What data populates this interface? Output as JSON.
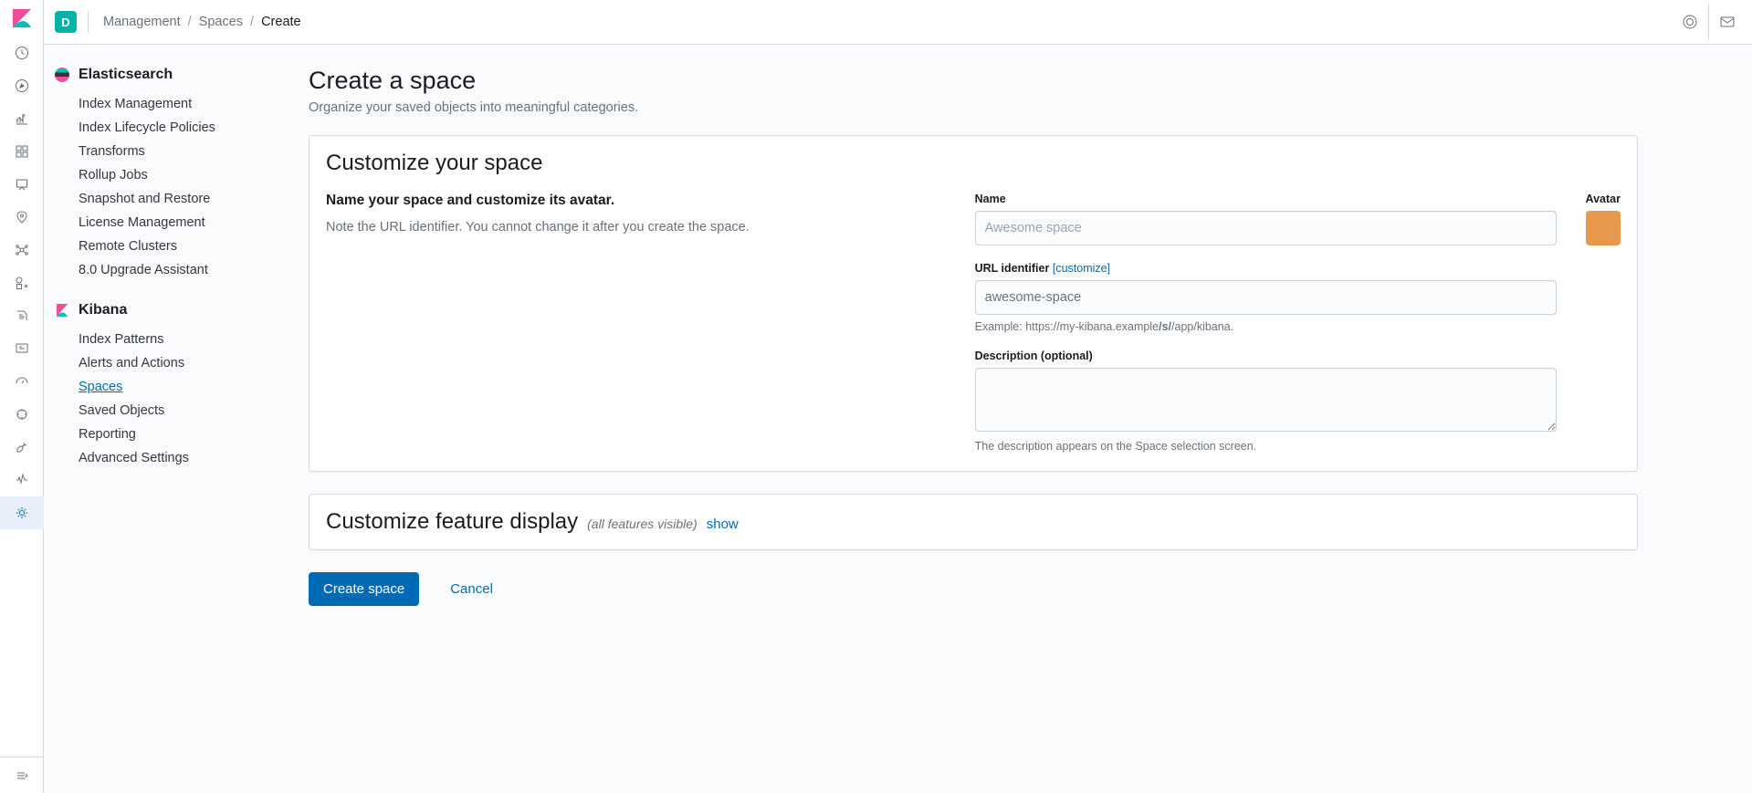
{
  "topbar": {
    "space_initial": "D",
    "breadcrumb": [
      "Management",
      "Spaces",
      "Create"
    ]
  },
  "sidebar": {
    "es": {
      "title": "Elasticsearch",
      "items": [
        "Index Management",
        "Index Lifecycle Policies",
        "Transforms",
        "Rollup Jobs",
        "Snapshot and Restore",
        "License Management",
        "Remote Clusters",
        "8.0 Upgrade Assistant"
      ]
    },
    "kib": {
      "title": "Kibana",
      "items": [
        "Index Patterns",
        "Alerts and Actions",
        "Spaces",
        "Saved Objects",
        "Reporting",
        "Advanced Settings"
      ],
      "active_index": 2
    }
  },
  "page": {
    "title": "Create a space",
    "subtitle": "Organize your saved objects into meaningful categories."
  },
  "customize": {
    "title": "Customize your space",
    "heading": "Name your space and customize its avatar.",
    "note": "Note the URL identifier. You cannot change it after you create the space.",
    "name_label": "Name",
    "name_placeholder": "Awesome space",
    "url_label": "URL identifier",
    "url_customize": "[customize]",
    "url_value": "awesome-space",
    "url_hint_prefix": "Example: https://my-kibana.example",
    "url_hint_bold": "/s/",
    "url_hint_suffix": "/app/kibana.",
    "desc_label": "Description (optional)",
    "desc_hint": "The description appears on the Space selection screen.",
    "avatar_label": "Avatar",
    "avatar_color": "#e6994c"
  },
  "features": {
    "title": "Customize feature display",
    "sub": "(all features visible)",
    "show": "show"
  },
  "actions": {
    "create": "Create space",
    "cancel": "Cancel"
  }
}
